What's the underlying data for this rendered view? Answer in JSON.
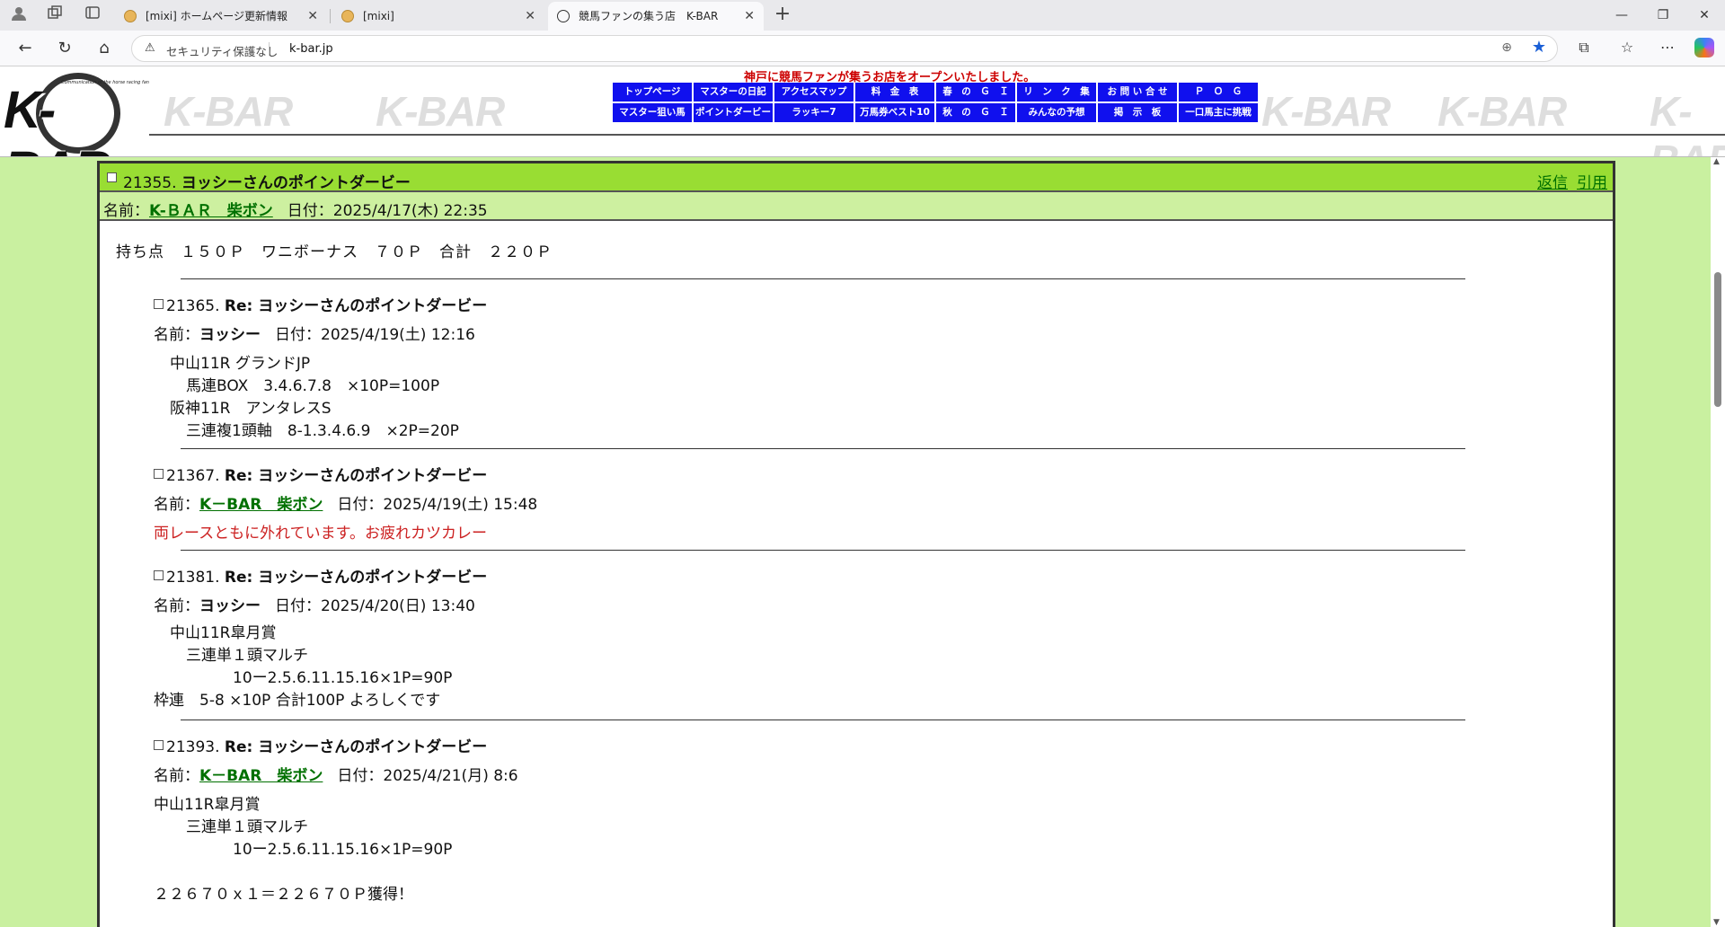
{
  "browser": {
    "tabs": [
      {
        "title": "[mixi] ホームページ更新情報",
        "active": false
      },
      {
        "title": "[mixi]",
        "active": false
      },
      {
        "title": "競馬ファンの集う店　K-BAR",
        "active": true
      }
    ],
    "security_label": "セキュリティ保護なし",
    "url": "k-bar.jp"
  },
  "site": {
    "logo_text": "K-BAR",
    "logo_sub": "Communication of the horse racing fan",
    "watermark": "K-BAR",
    "notice": "神戸に競馬ファンが集うお店をオープンいたしました。",
    "menu": [
      "トップページ",
      "マスターの日記",
      "アクセスマップ",
      "料　金　表",
      "春　の　Ｇ　Ｉ",
      "リ　ン　ク　集",
      "お 問 い 合 せ",
      "Ｐ　Ｏ　Ｇ",
      "マスター狙い馬",
      "ポイントダービー",
      "ラッキー7",
      "万馬券ベスト10",
      "秋　の　Ｇ　Ｉ",
      "みんなの予想",
      "掲　示　板",
      "一口馬主に挑戦"
    ]
  },
  "post": {
    "number": "21355.",
    "title": "ヨッシーさんのポイントダービー",
    "reply_label": "返信",
    "quote_label": "引用",
    "name_label": "名前：",
    "author": "K-ＢＡＲ　柴ボン",
    "date_label": "日付：",
    "date": "2025/4/17(木) 22:35",
    "body": "持ち点　１５０Ｐ　ワニボーナス　７０Ｐ　合計　２２０Ｐ"
  },
  "replies": [
    {
      "number": "21365.",
      "title": "Re: ヨッシーさんのポイントダービー",
      "name_label": "名前：",
      "author": "ヨッシー",
      "author_link": false,
      "date_label": "日付：",
      "date": "2025/4/19(土) 12:16",
      "lines": [
        "中山11R グランドJP",
        "馬連BOX　3.4.6.7.8　×10P=100P",
        "阪神11R　アンタレスS",
        "三連複1頭軸　8-1.3.4.6.9　×2P=20P"
      ]
    },
    {
      "number": "21367.",
      "title": "Re: ヨッシーさんのポイントダービー",
      "name_label": "名前：",
      "author": "K－BAR　柴ボン",
      "author_link": true,
      "date_label": "日付：",
      "date": "2025/4/19(土) 15:48",
      "lines": [
        "両レースともに外れています。お疲れカツカレー"
      ]
    },
    {
      "number": "21381.",
      "title": "Re: ヨッシーさんのポイントダービー",
      "name_label": "名前：",
      "author": "ヨッシー",
      "author_link": false,
      "date_label": "日付：",
      "date": "2025/4/20(日) 13:40",
      "lines": [
        "中山11R皐月賞",
        "三連単１頭マルチ",
        "10ー2.5.6.11.15.16×1P=90P",
        "枠連　5-8 ×10P 合計100P よろしくです"
      ]
    },
    {
      "number": "21393.",
      "title": "Re: ヨッシーさんのポイントダービー",
      "name_label": "名前：",
      "author": "K－BAR　柴ボン",
      "author_link": true,
      "date_label": "日付：",
      "date": "2025/4/21(月) 8:6",
      "lines": [
        "中山11R皐月賞",
        "三連単１頭マルチ",
        "10ー2.5.6.11.15.16×1P=90P",
        "２２６７０ｘ１＝２２６７０Ｐ獲得！"
      ]
    }
  ],
  "colors": {
    "page_bg": "#c9f0a0",
    "header_bar": "#99dd33",
    "meta_bar": "#cdf0a0",
    "menu_bg": "#1010ee",
    "link": "#007000",
    "notice": "#cc0000",
    "reply_red": "#cc2222"
  }
}
